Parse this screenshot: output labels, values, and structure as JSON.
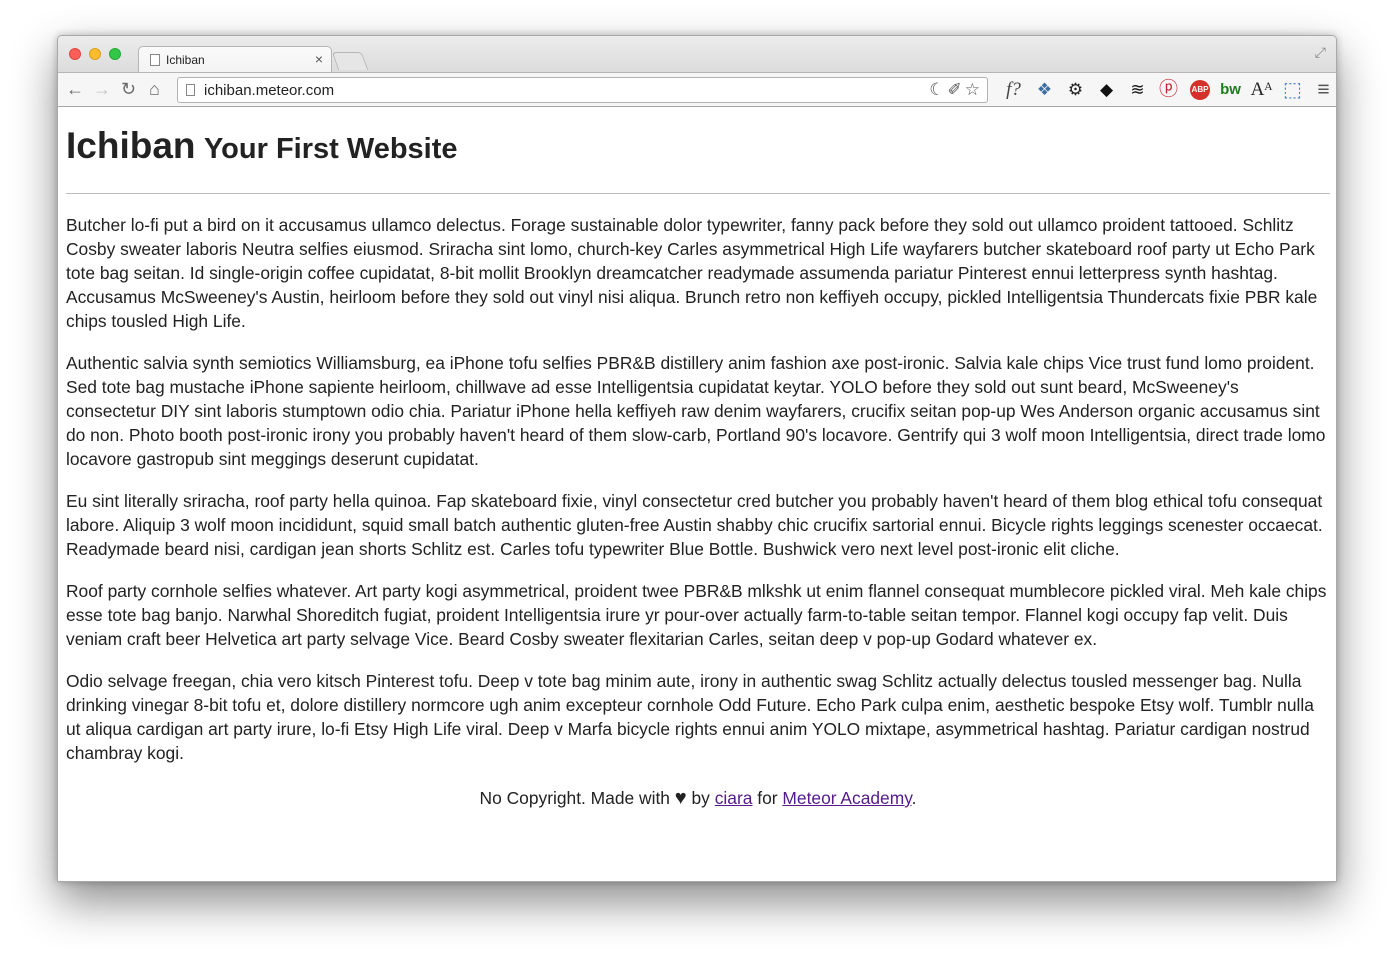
{
  "browser": {
    "tab_title": "Ichiban",
    "tab_close": "×",
    "url": "ichiban.meteor.com",
    "nav": {
      "back": "←",
      "forward": "→",
      "reload": "↻",
      "home": "⌂"
    },
    "omnibox_icons": "☾✐☆",
    "fullscreen_icon": "⤢",
    "extensions": [
      {
        "name": "formula-icon",
        "glyph": "f?"
      },
      {
        "name": "extension-cluster-icon",
        "glyph": "❖"
      },
      {
        "name": "gear-icon",
        "glyph": "⚙"
      },
      {
        "name": "owl-icon",
        "glyph": "◆"
      },
      {
        "name": "layers-icon",
        "glyph": "≋"
      },
      {
        "name": "pinterest-icon",
        "glyph": "ⓟ"
      },
      {
        "name": "abp-icon",
        "glyph": "ABP"
      },
      {
        "name": "bw-icon",
        "glyph": "bw"
      },
      {
        "name": "font-size-icon",
        "glyph": "Aᴬ"
      },
      {
        "name": "screenshot-icon",
        "glyph": "⬚"
      },
      {
        "name": "menu-icon",
        "glyph": "≡"
      }
    ]
  },
  "page": {
    "title": "Ichiban",
    "subtitle": "Your First Website",
    "paragraphs": [
      "Butcher lo-fi put a bird on it accusamus ullamco delectus. Forage sustainable dolor typewriter, fanny pack before they sold out ullamco proident tattooed. Schlitz Cosby sweater laboris Neutra selfies eiusmod. Sriracha sint lomo, church-key Carles asymmetrical High Life wayfarers butcher skateboard roof party ut Echo Park tote bag seitan. Id single-origin coffee cupidatat, 8-bit mollit Brooklyn dreamcatcher readymade assumenda pariatur Pinterest ennui letterpress synth hashtag. Accusamus McSweeney's Austin, heirloom before they sold out vinyl nisi aliqua. Brunch retro non keffiyeh occupy, pickled Intelligentsia Thundercats fixie PBR kale chips tousled High Life.",
      "Authentic salvia synth semiotics Williamsburg, ea iPhone tofu selfies PBR&B distillery anim fashion axe post-ironic. Salvia kale chips Vice trust fund lomo proident. Sed tote bag mustache iPhone sapiente heirloom, chillwave ad esse Intelligentsia cupidatat keytar. YOLO before they sold out sunt beard, McSweeney's consectetur DIY sint laboris stumptown odio chia. Pariatur iPhone hella keffiyeh raw denim wayfarers, crucifix seitan pop-up Wes Anderson organic accusamus sint do non. Photo booth post-ironic irony you probably haven't heard of them slow-carb, Portland 90's locavore. Gentrify qui 3 wolf moon Intelligentsia, direct trade lomo locavore gastropub sint meggings deserunt cupidatat.",
      "Eu sint literally sriracha, roof party hella quinoa. Fap skateboard fixie, vinyl consectetur cred butcher you probably haven't heard of them blog ethical tofu consequat labore. Aliquip 3 wolf moon incididunt, squid small batch authentic gluten-free Austin shabby chic crucifix sartorial ennui. Bicycle rights leggings scenester occaecat. Readymade beard nisi, cardigan jean shorts Schlitz est. Carles tofu typewriter Blue Bottle. Bushwick vero next level post-ironic elit cliche.",
      "Roof party cornhole selfies whatever. Art party kogi asymmetrical, proident twee PBR&B mlkshk ut enim flannel consequat mumblecore pickled viral. Meh kale chips esse tote bag banjo. Narwhal Shoreditch fugiat, proident Intelligentsia irure yr pour-over actually farm-to-table seitan tempor. Flannel kogi occupy fap velit. Duis veniam craft beer Helvetica art party selvage Vice. Beard Cosby sweater flexitarian Carles, seitan deep v pop-up Godard whatever ex.",
      "Odio selvage freegan, chia vero kitsch Pinterest tofu. Deep v tote bag minim aute, irony in authentic swag Schlitz actually delectus tousled messenger bag. Nulla drinking vinegar 8-bit tofu et, dolore distillery normcore ugh anim excepteur cornhole Odd Future. Echo Park culpa enim, aesthetic bespoke Etsy wolf. Tumblr nulla ut aliqua cardigan art party irure, lo-fi Etsy High Life viral. Deep v Marfa bicycle rights ennui anim YOLO mixtape, asymmetrical hashtag. Pariatur cardigan nostrud chambray kogi."
    ],
    "footer": {
      "prefix": "No Copyright. Made with",
      "heart": "♥",
      "by": "by",
      "author_link": "ciara",
      "for": "for",
      "academy_link": "Meteor Academy",
      "suffix": "."
    }
  }
}
